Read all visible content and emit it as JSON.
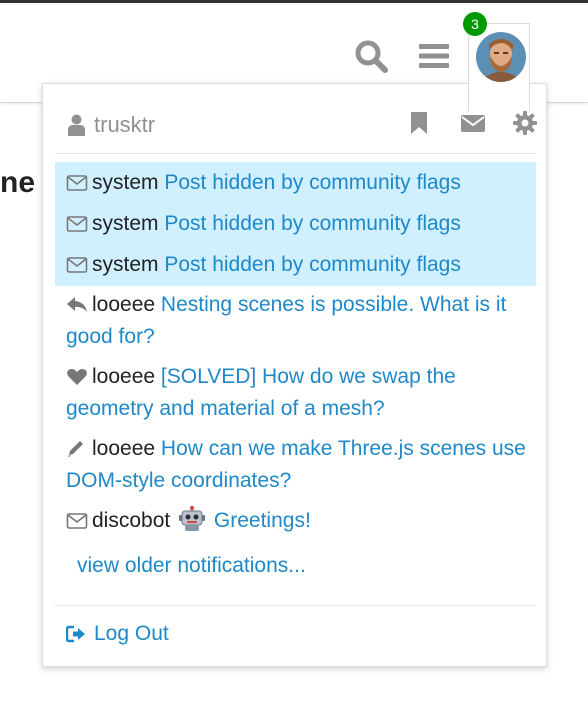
{
  "header": {
    "notification_count": "3",
    "icons": {
      "search": "search-icon",
      "menu": "hamburger-icon",
      "avatar": "user-avatar"
    }
  },
  "page": {
    "heading_fragment": "ne"
  },
  "user_menu": {
    "username": "trusktr",
    "header_icons": [
      "user-icon",
      "bookmark-icon",
      "envelope-icon",
      "gear-icon"
    ],
    "notifications": [
      {
        "icon": "envelope-outline-icon",
        "user": "system",
        "text": "Post hidden by community flags",
        "unread": true
      },
      {
        "icon": "envelope-outline-icon",
        "user": "system",
        "text": "Post hidden by community flags",
        "unread": true
      },
      {
        "icon": "envelope-outline-icon",
        "user": "system",
        "text": "Post hidden by community flags",
        "unread": true
      },
      {
        "icon": "reply-icon",
        "user": "looeee",
        "text": "Nesting scenes is possible. What is it good for?",
        "unread": false
      },
      {
        "icon": "heart-icon",
        "user": "looeee",
        "text": "[SOLVED] How do we swap the geometry and material of a mesh?",
        "unread": false
      },
      {
        "icon": "pencil-icon",
        "user": "looeee",
        "text": "How can we make Three.js scenes use DOM-style coordinates?",
        "unread": false
      },
      {
        "icon": "envelope-outline-icon",
        "user": "discobot",
        "emoji": "robot-emoji",
        "text": "Greetings!",
        "unread": false
      }
    ],
    "view_older": "view older notifications...",
    "logout": "Log Out"
  },
  "colors": {
    "link": "#1e88c8",
    "unread_bg": "#d1f0ff",
    "badge": "#009900",
    "muted_icon": "#919191",
    "header_border": "#333333"
  }
}
